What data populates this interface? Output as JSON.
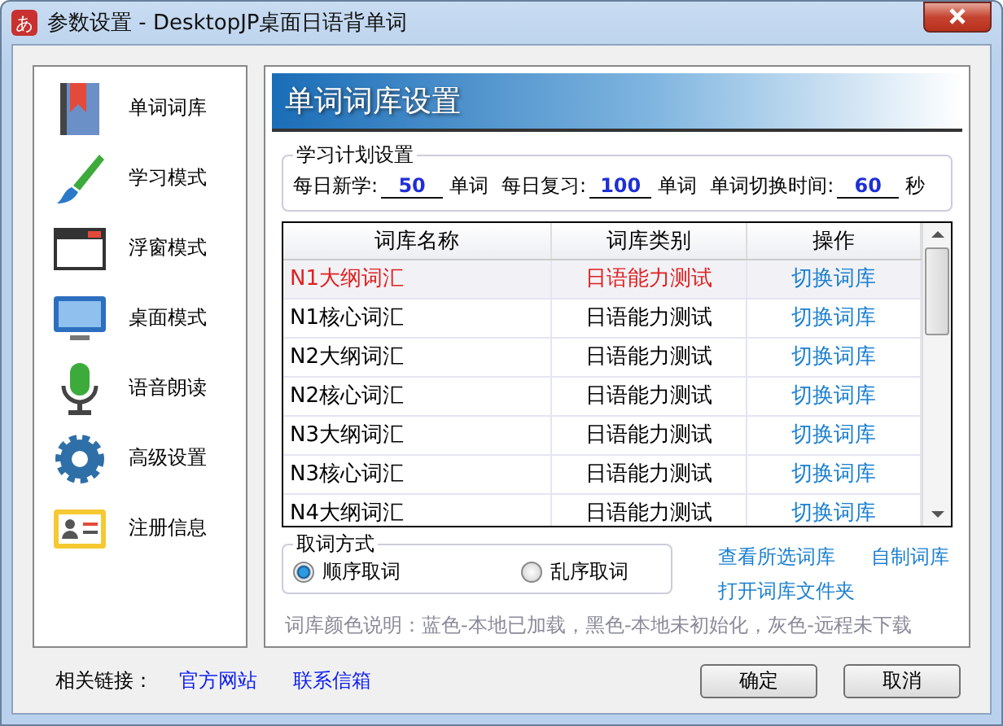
{
  "window": {
    "title": "参数设置 - DesktopJP桌面日语背单词",
    "app_icon": "あ"
  },
  "sidebar": {
    "items": [
      {
        "label": "单词词库",
        "kind": "book"
      },
      {
        "label": "学习模式",
        "kind": "brush"
      },
      {
        "label": "浮窗模式",
        "kind": "window"
      },
      {
        "label": "桌面模式",
        "kind": "monitor"
      },
      {
        "label": "语音朗读",
        "kind": "mic"
      },
      {
        "label": "高级设置",
        "kind": "gear"
      },
      {
        "label": "注册信息",
        "kind": "card"
      }
    ]
  },
  "panel": {
    "title": "单词词库设置",
    "plan": {
      "legend": "学习计划设置",
      "fields": [
        {
          "label": "每日新学:",
          "value": "50",
          "unit": "单词"
        },
        {
          "label": "每日复习:",
          "value": "100",
          "unit": "单词"
        },
        {
          "label": "单词切换时间:",
          "value": "60",
          "unit": "秒"
        }
      ]
    },
    "table": {
      "columns": [
        "词库名称",
        "词库类别",
        "操作"
      ],
      "rows": [
        {
          "name": "N1大纲词汇",
          "category": "日语能力测试",
          "action": "切换词库",
          "selected": true
        },
        {
          "name": "N1核心词汇",
          "category": "日语能力测试",
          "action": "切换词库",
          "selected": false
        },
        {
          "name": "N2大纲词汇",
          "category": "日语能力测试",
          "action": "切换词库",
          "selected": false
        },
        {
          "name": "N2核心词汇",
          "category": "日语能力测试",
          "action": "切换词库",
          "selected": false
        },
        {
          "name": "N3大纲词汇",
          "category": "日语能力测试",
          "action": "切换词库",
          "selected": false
        },
        {
          "name": "N3核心词汇",
          "category": "日语能力测试",
          "action": "切换词库",
          "selected": false
        },
        {
          "name": "N4大纲词汇",
          "category": "日语能力测试",
          "action": "切换词库",
          "selected": false
        }
      ]
    },
    "order": {
      "legend": "取词方式",
      "options": [
        {
          "label": "顺序取词",
          "selected": true
        },
        {
          "label": "乱序取词",
          "selected": false
        }
      ]
    },
    "links": [
      "查看所选词库",
      "自制词库",
      "打开词库文件夹"
    ],
    "legend_note": "词库颜色说明：蓝色-本地已加载，黑色-本地未初始化，灰色-远程未下载"
  },
  "footer": {
    "label": "相关链接：",
    "links": [
      "官方网站",
      "联系信箱"
    ],
    "buttons": [
      "确定",
      "取消"
    ]
  }
}
